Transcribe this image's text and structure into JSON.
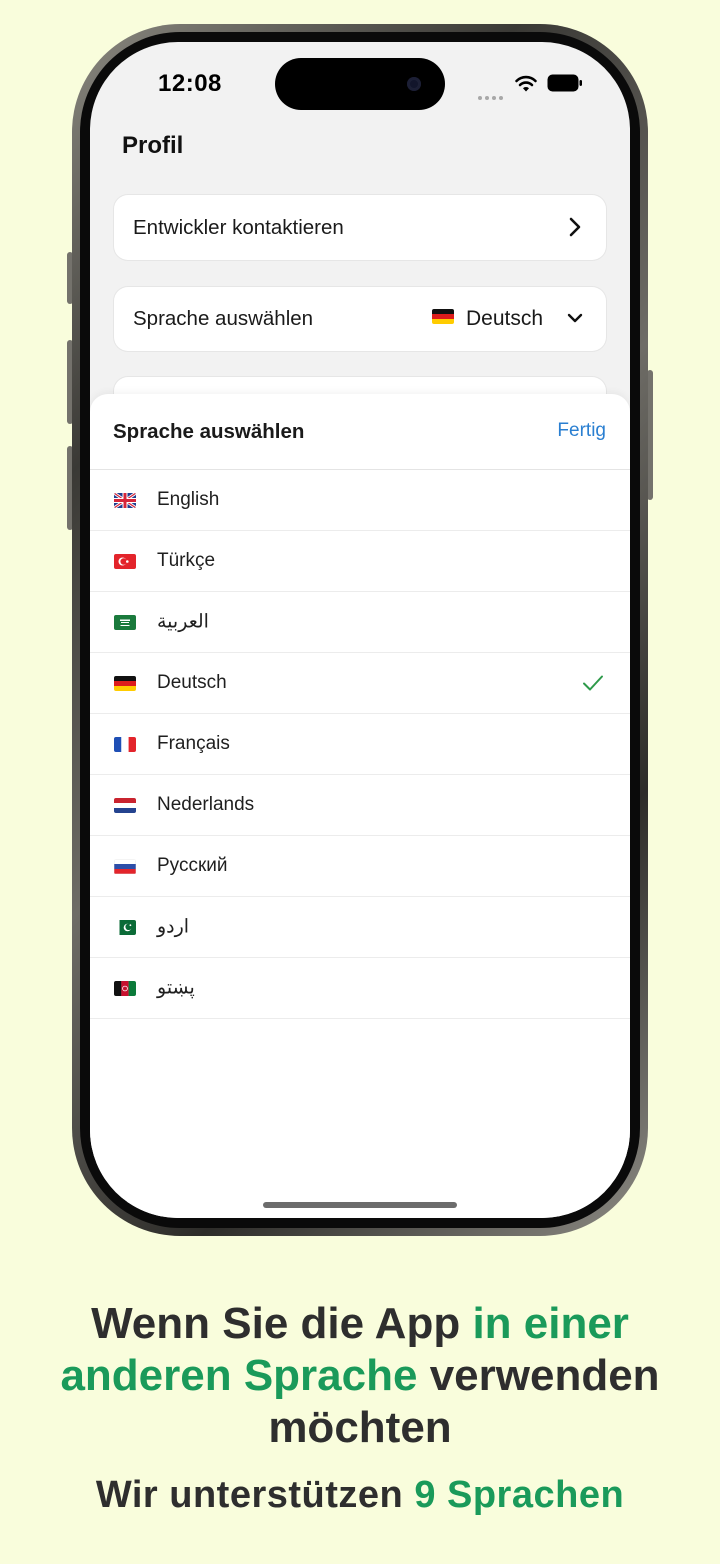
{
  "status_bar": {
    "time": "12:08"
  },
  "profile": {
    "title": "Profil",
    "contact_label": "Entwickler kontaktieren",
    "language_label": "Sprache auswählen",
    "language_value": "Deutsch"
  },
  "sheet": {
    "title": "Sprache auswählen",
    "done_label": "Fertig",
    "languages": [
      {
        "label": "English",
        "flag": "uk"
      },
      {
        "label": "Türkçe",
        "flag": "tr"
      },
      {
        "label": "العربية",
        "flag": "sa"
      },
      {
        "label": "Deutsch",
        "flag": "de",
        "selected": true
      },
      {
        "label": "Français",
        "flag": "fr"
      },
      {
        "label": "Nederlands",
        "flag": "nl"
      },
      {
        "label": "Русский",
        "flag": "ru"
      },
      {
        "label": "اردو",
        "flag": "pk"
      },
      {
        "label": "پښتو",
        "flag": "af"
      }
    ]
  },
  "caption": {
    "headline_part1": "Wenn Sie die App ",
    "headline_accent": "in einer anderen Sprache",
    "headline_part2": " verwenden möchten",
    "subhead_part1": "Wir unterstützen ",
    "subhead_accent": "9 Sprachen"
  },
  "colors": {
    "background": "#f9fddc",
    "accent_green": "#1a9a5a",
    "link_blue": "#2a7fd1",
    "check_green": "#2e9a4a"
  }
}
